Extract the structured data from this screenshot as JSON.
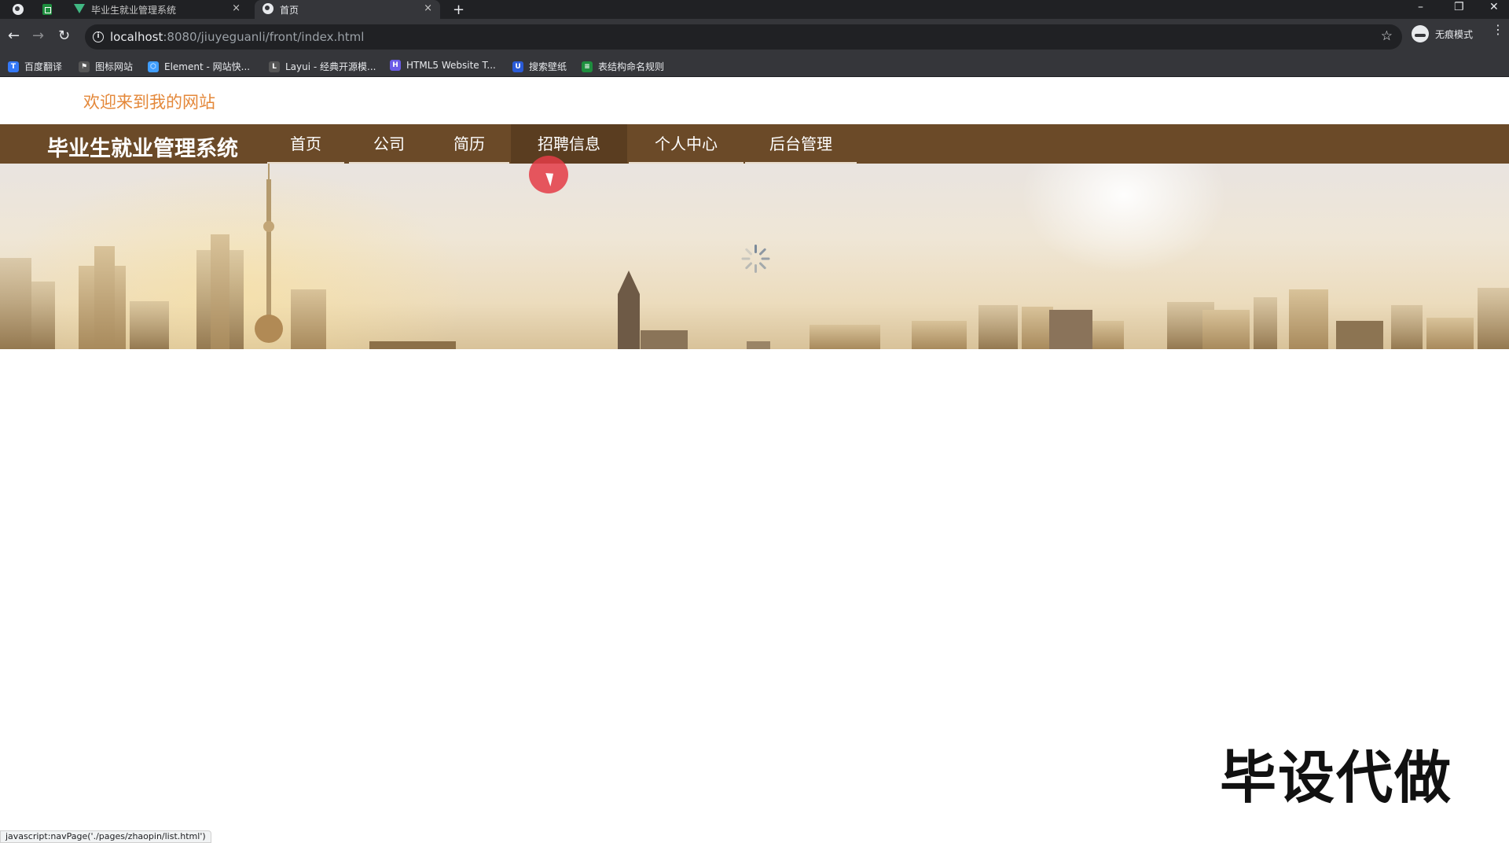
{
  "browser": {
    "tabs": [
      {
        "title": "毕业生就业管理系统",
        "icon": "vue-icon",
        "close": "×"
      },
      {
        "title": "首页",
        "icon": "globe-icon",
        "close": "×"
      }
    ],
    "new_tab": "+",
    "window_controls": {
      "minimize": "–",
      "restore": "❐",
      "close": "✕"
    },
    "nav": {
      "back": "←",
      "forward": "→",
      "reload": "↻"
    },
    "url_host": "localhost",
    "url_path": ":8080/jiuyeguanli/front/index.html",
    "info": "i",
    "star": "☆",
    "profile_label": "无痕模式",
    "menu": "⋮",
    "bookmarks": [
      {
        "label": "百度翻译",
        "icon": "baidu-translate-icon",
        "glyph": "T",
        "color": "#3478f6"
      },
      {
        "label": "图标网站",
        "icon": "flag-icon",
        "glyph": "⚑",
        "color": "#555555"
      },
      {
        "label": "Element - 网站快...",
        "icon": "element-icon",
        "glyph": "⬡",
        "color": "#409eff"
      },
      {
        "label": "Layui - 经典开源模...",
        "icon": "layui-icon",
        "glyph": "L",
        "color": "#555555"
      },
      {
        "label": "HTML5 Website T...",
        "icon": "html5-template-icon",
        "glyph": "H",
        "color": "#6c5ce7"
      },
      {
        "label": "搜索壁纸",
        "icon": "wallpaper-search-icon",
        "glyph": "U",
        "color": "#2a5bd7"
      },
      {
        "label": "表结构命名规则",
        "icon": "sheet-icon",
        "glyph": "≡",
        "color": "#1e8e3e"
      }
    ]
  },
  "page": {
    "welcome": "欢迎来到我的网站",
    "site_title": "毕业生就业管理系统",
    "nav_items": [
      "首页",
      "公司",
      "简历",
      "招聘信息",
      "个人中心",
      "后台管理"
    ],
    "active_nav": "招聘信息",
    "watermark": "毕设代做",
    "status_url": "javascript:navPage('./pages/zhaopin/list.html')"
  },
  "colors": {
    "navbar": "#6b4a28",
    "navbar_active": "#5a3d20",
    "welcome_text": "#e4883a",
    "cursor_highlight": "#e43c46"
  }
}
